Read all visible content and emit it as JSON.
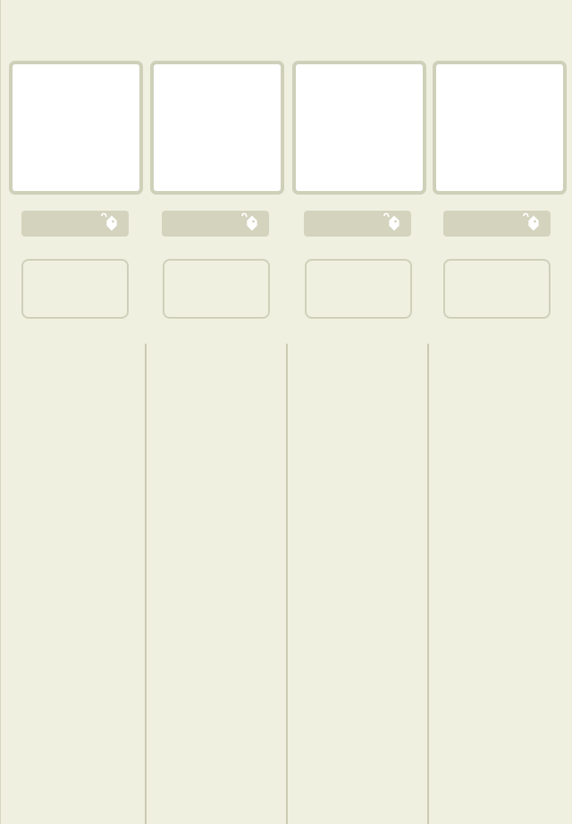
{
  "columns": [
    {
      "card": "",
      "tag_icon": "tag-icon",
      "slot": ""
    },
    {
      "card": "",
      "tag_icon": "tag-icon",
      "slot": ""
    },
    {
      "card": "",
      "tag_icon": "tag-icon",
      "slot": ""
    },
    {
      "card": "",
      "tag_icon": "tag-icon",
      "slot": ""
    }
  ],
  "colors": {
    "background": "#f0f0e1",
    "card_border": "#cfd0b9",
    "tag_bar": "#d3d3be",
    "divider": "#cbcbb3"
  }
}
